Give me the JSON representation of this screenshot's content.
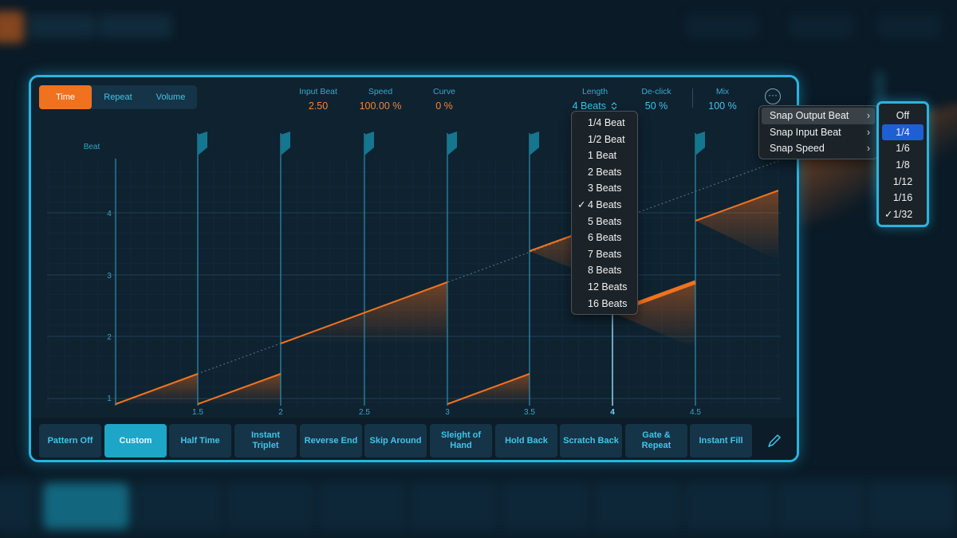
{
  "modes": [
    {
      "label": "Time",
      "active": true
    },
    {
      "label": "Repeat",
      "active": false
    },
    {
      "label": "Volume",
      "active": false
    }
  ],
  "params": {
    "input_beat": {
      "label": "Input Beat",
      "value": "2.50"
    },
    "speed": {
      "label": "Speed",
      "value": "100.00 %"
    },
    "curve": {
      "label": "Curve",
      "value": "0 %"
    },
    "length": {
      "label": "Length",
      "value": "4 Beats",
      "icon": "updown-chevron-icon"
    },
    "declick": {
      "label": "De-click",
      "value": "50 %"
    },
    "mix": {
      "label": "Mix",
      "value": "100 %"
    }
  },
  "more_icon": "ellipsis-circle-icon",
  "graph": {
    "y_label": "Beat",
    "y_ticks": [
      "1",
      "2",
      "3",
      "4"
    ],
    "x_ticks": [
      "1.5",
      "2",
      "2.5",
      "3",
      "3.5",
      "4",
      "4.5"
    ],
    "highlight_x_tick": "4"
  },
  "length_menu": {
    "items": [
      "1/4 Beat",
      "1/2 Beat",
      "1 Beat",
      "2 Beats",
      "3 Beats",
      "4 Beats",
      "5 Beats",
      "6 Beats",
      "7 Beats",
      "8 Beats",
      "12 Beats",
      "16 Beats"
    ],
    "checked_index": 5,
    "check_glyph": "✓"
  },
  "snap_menu": {
    "items": [
      "Snap Output Beat",
      "Snap Input Beat",
      "Snap Speed"
    ],
    "open_index": 0,
    "arrow_glyph": "›"
  },
  "snap_submenu": {
    "items": [
      "Off",
      "1/4",
      "1/6",
      "1/8",
      "1/12",
      "1/16",
      "1/32"
    ],
    "highlight_index": 1,
    "checked_index": 6,
    "check_glyph": "✓"
  },
  "presets": [
    {
      "label": "Pattern Off",
      "active": false
    },
    {
      "label": "Custom",
      "active": true
    },
    {
      "label": "Half Time",
      "active": false
    },
    {
      "label": "Instant Triplet",
      "active": false
    },
    {
      "label": "Reverse End",
      "active": false
    },
    {
      "label": "Skip Around",
      "active": false
    },
    {
      "label": "Sleight of Hand",
      "active": false
    },
    {
      "label": "Hold Back",
      "active": false
    },
    {
      "label": "Scratch Back",
      "active": false
    },
    {
      "label": "Gate & Repeat",
      "active": false
    },
    {
      "label": "Instant Fill",
      "active": false
    }
  ],
  "pencil_icon": "pencil-icon",
  "colors": {
    "accent_orange": "#f0721f",
    "accent_cyan": "#2ab4e0",
    "menu_highlight": "#1f5fd4"
  }
}
